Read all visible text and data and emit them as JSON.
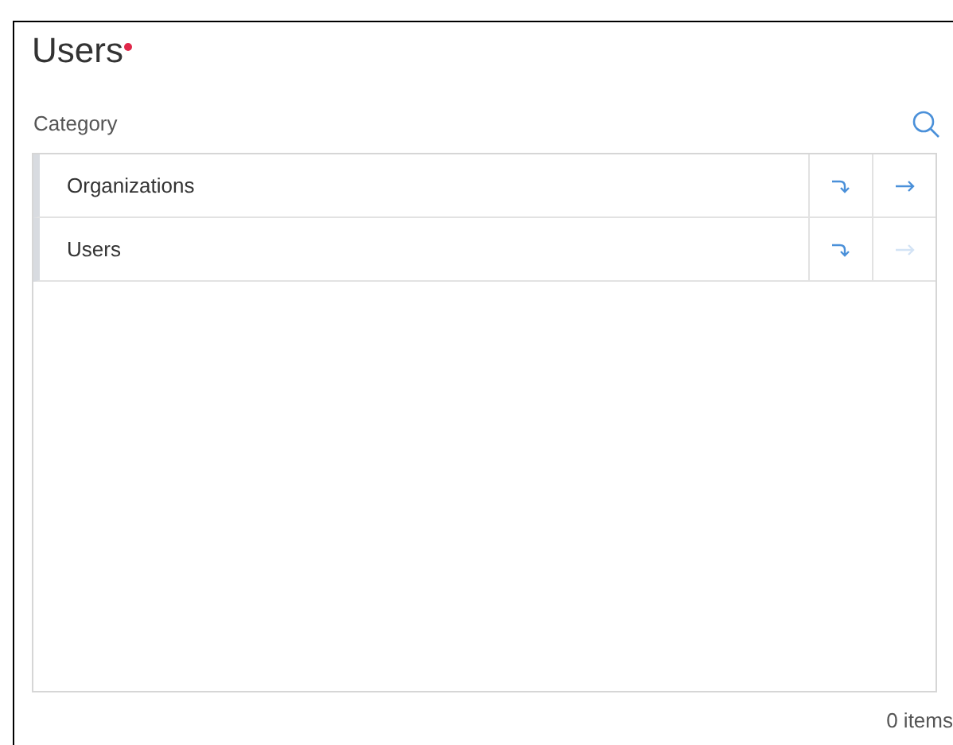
{
  "title": "Users",
  "required": true,
  "category_label": "Category",
  "rows": [
    {
      "label": "Organizations",
      "drill_disabled": false,
      "next_disabled": false
    },
    {
      "label": "Users",
      "drill_disabled": false,
      "next_disabled": true
    }
  ],
  "item_count": "0 items"
}
